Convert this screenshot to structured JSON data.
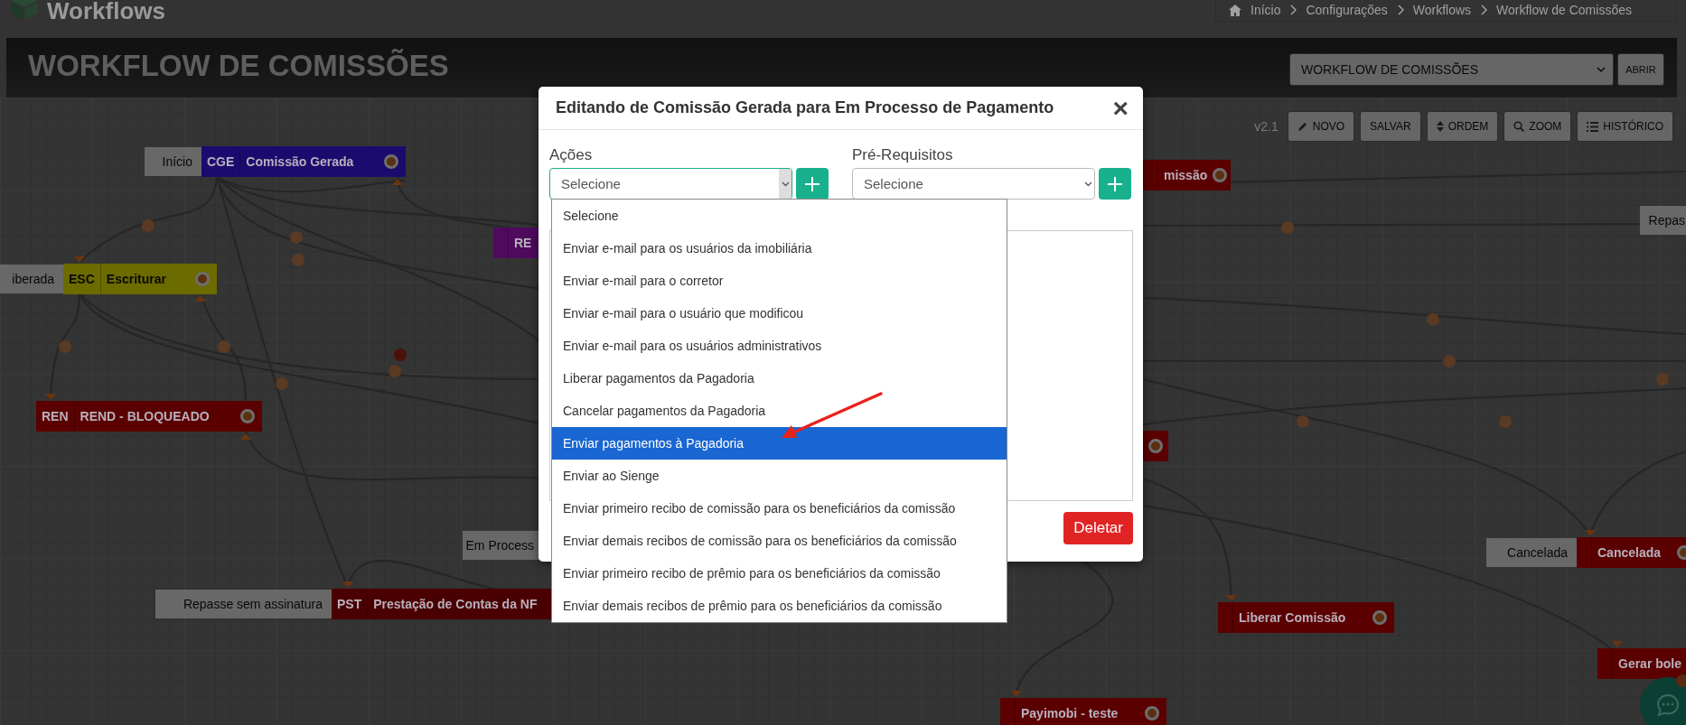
{
  "header": {
    "title": "Workflows",
    "breadcrumb": [
      "Início",
      "Configurações",
      "Workflows",
      "Workflow de Comissões"
    ]
  },
  "title_bar": {
    "title": "WORKFLOW DE COMISSÕES",
    "workflow_select": "WORKFLOW DE COMISSÕES",
    "open_button": "ABRIR"
  },
  "toolbar": {
    "version": "v2.1",
    "buttons": [
      "NOVO",
      "SALVAR",
      "ORDEM",
      "ZOOM",
      "HISTÓRICO"
    ]
  },
  "nodes": [
    {
      "label": "Início",
      "code": "CGE",
      "title": "Comissão Gerada",
      "color": "#1c0b6e",
      "end_marker": true
    },
    {
      "label": "iberada",
      "code": "ESC",
      "title": "Escriturar",
      "color": "#6b6b00",
      "end_marker": true
    },
    {
      "title": "RE",
      "color": "#4f0a5e",
      "end_marker": false
    },
    {
      "code": "REN",
      "title": "REND - BLOQUEADO",
      "color": "#5a0000",
      "end_marker": true
    },
    {
      "label": "Repasse sem assinatura",
      "code": "PST",
      "title": "Prestação de Contas da NF",
      "color": "#4a0000",
      "end_marker": false
    },
    {
      "title": "missão",
      "color": "#5a0000",
      "end_marker": true
    },
    {
      "color": "#5a0000",
      "end_marker": true
    },
    {
      "label": "Cancelada",
      "title": "Cancelada",
      "color": "#5a0000",
      "end_marker": true
    },
    {
      "title": "Liberar Comissão",
      "color": "#5a0000",
      "end_marker": true
    },
    {
      "title": "Gerar bole",
      "color": "#5a0000",
      "end_marker": false
    },
    {
      "title": "Payimobi - teste",
      "color": "#5a0000",
      "end_marker": true
    }
  ],
  "state_labels": [
    "Em Process",
    "Repas"
  ],
  "modal": {
    "title": "Editando de Comissão Gerada para Em Processo de Pagamento",
    "close": "×",
    "actions": {
      "label": "Ações",
      "value": "Selecione",
      "open": true
    },
    "prerequisites": {
      "label": "Pré-Requisitos",
      "value": "Selecione"
    },
    "delete_button": "Deletar",
    "options": [
      {
        "label": "Selecione",
        "selected": false
      },
      {
        "label": "Enviar e-mail para os usuários da imobiliária",
        "selected": false
      },
      {
        "label": "Enviar e-mail para o corretor",
        "selected": false
      },
      {
        "label": "Enviar e-mail para o usuário que modificou",
        "selected": false
      },
      {
        "label": "Enviar e-mail para os usuários administrativos",
        "selected": false
      },
      {
        "label": "Liberar pagamentos da Pagadoria",
        "selected": false
      },
      {
        "label": "Cancelar pagamentos da Pagadoria",
        "selected": false
      },
      {
        "label": "Enviar pagamentos à Pagadoria",
        "selected": true
      },
      {
        "label": "Enviar ao Sienge",
        "selected": false
      },
      {
        "label": "Enviar primeiro recibo de comissão para os beneficiários da comissão",
        "selected": false
      },
      {
        "label": "Enviar demais recibos de comissão para os beneficiários da comissão",
        "selected": false
      },
      {
        "label": "Enviar primeiro recibo de prêmio para os beneficiários da comissão",
        "selected": false
      },
      {
        "label": "Enviar demais recibos de prêmio para os beneficiários da comissão",
        "selected": false
      }
    ]
  }
}
